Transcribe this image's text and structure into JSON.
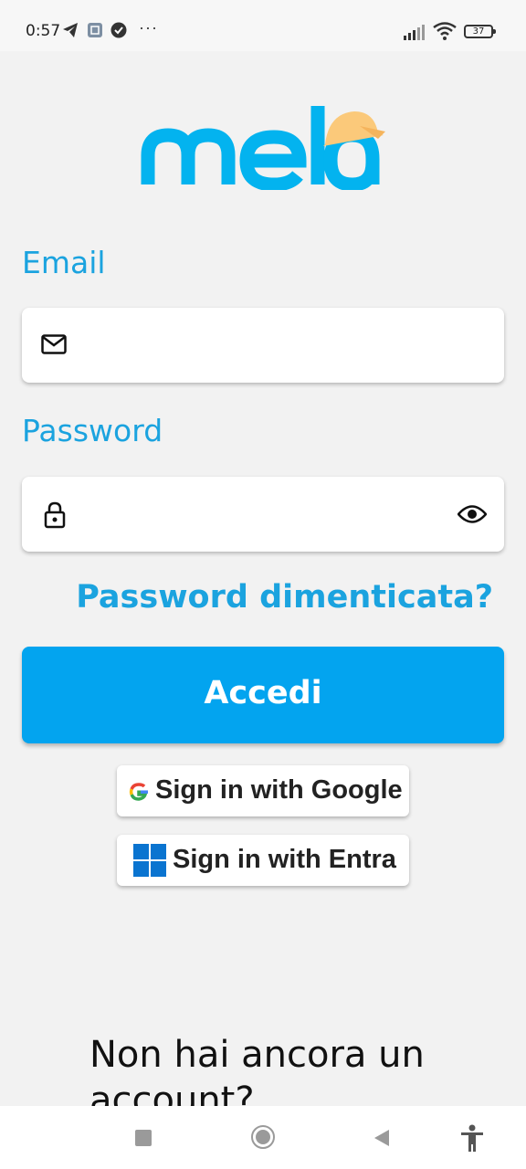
{
  "status_bar": {
    "time": "0:57",
    "battery": "37",
    "icons": [
      "telegram-icon",
      "app-notification-icon",
      "check-circle-icon",
      "more-dots-icon",
      "signal-icon",
      "wifi-icon",
      "battery-icon"
    ]
  },
  "logo": {
    "text": "mela",
    "color": "#03b3ef",
    "hat_color": "#fbc97a"
  },
  "form": {
    "email_label": "Email",
    "email_value": "",
    "password_label": "Password",
    "password_value": "",
    "forgot_label": "Password dimenticata?",
    "login_label": "Accedi"
  },
  "sso": {
    "google_label": "Sign in with Google",
    "entra_label": "Sign in with Entra"
  },
  "signup": {
    "text": "Non hai ancora un account?"
  },
  "colors": {
    "accent": "#03a4ef",
    "label": "#1ba3df",
    "background": "#f2f2f2"
  }
}
